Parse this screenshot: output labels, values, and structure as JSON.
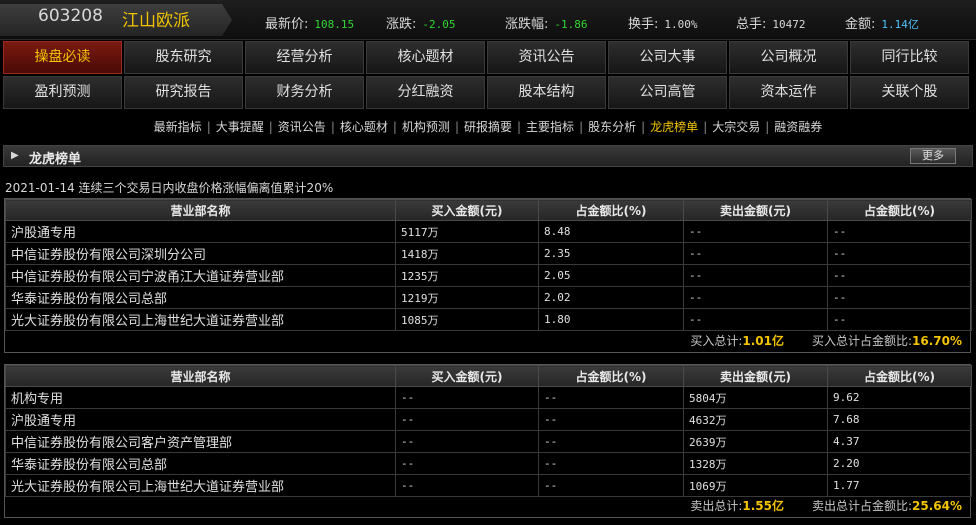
{
  "header": {
    "code": "603208",
    "name": "江山欧派",
    "quotes": [
      {
        "label": "最新价:",
        "value": "108.15",
        "color": "#33d633"
      },
      {
        "label": "涨跌:",
        "value": "-2.05",
        "color": "#33d633"
      },
      {
        "label": "涨跌幅:",
        "value": "-1.86",
        "color": "#33d633"
      },
      {
        "label": "换手:",
        "value": "1.00%",
        "color": "#d8d8d8"
      },
      {
        "label": "总手:",
        "value": "10472",
        "color": "#d8d8d8"
      },
      {
        "label": "金额:",
        "value": "1.14亿",
        "color": "#4fc3ff"
      }
    ]
  },
  "nav": {
    "row1": [
      "操盘必读",
      "股东研究",
      "经营分析",
      "核心题材",
      "资讯公告",
      "公司大事",
      "公司概况",
      "同行比较"
    ],
    "row2": [
      "盈利预测",
      "研究报告",
      "财务分析",
      "分红融资",
      "股本结构",
      "公司高管",
      "资本运作",
      "关联个股"
    ],
    "active": "操盘必读"
  },
  "subnav": {
    "items": [
      "最新指标",
      "大事提醒",
      "资讯公告",
      "核心题材",
      "机构预测",
      "研报摘要",
      "主要指标",
      "股东分析",
      "龙虎榜单",
      "大宗交易",
      "融资融券"
    ],
    "active": "龙虎榜单"
  },
  "section": {
    "title": "龙虎榜单",
    "more_label": "更多"
  },
  "caption": "2021-01-14 连续三个交易日内收盘价格涨幅偏离值累计20%",
  "buy_table": {
    "headers": [
      "营业部名称",
      "买入金额(元)",
      "占金额比(%)",
      "卖出金额(元)",
      "占金额比(%)"
    ],
    "rows": [
      [
        "沪股通专用",
        "5117万",
        "8.48",
        "--",
        "--"
      ],
      [
        "中信证券股份有限公司深圳分公司",
        "1418万",
        "2.35",
        "--",
        "--"
      ],
      [
        "中信证券股份有限公司宁波甬江大道证券营业部",
        "1235万",
        "2.05",
        "--",
        "--"
      ],
      [
        "华泰证券股份有限公司总部",
        "1219万",
        "2.02",
        "--",
        "--"
      ],
      [
        "光大证券股份有限公司上海世纪大道证券营业部",
        "1085万",
        "1.80",
        "--",
        "--"
      ]
    ],
    "summary": [
      {
        "label": "买入总计:",
        "value": "1.01亿"
      },
      {
        "label": "买入总计占金额比:",
        "value": "16.70%"
      }
    ]
  },
  "sell_table": {
    "headers": [
      "营业部名称",
      "买入金额(元)",
      "占金额比(%)",
      "卖出金额(元)",
      "占金额比(%)"
    ],
    "rows": [
      [
        "机构专用",
        "--",
        "--",
        "5804万",
        "9.62"
      ],
      [
        "沪股通专用",
        "--",
        "--",
        "4632万",
        "7.68"
      ],
      [
        "中信证券股份有限公司客户资产管理部",
        "--",
        "--",
        "2639万",
        "4.37"
      ],
      [
        "华泰证券股份有限公司总部",
        "--",
        "--",
        "1328万",
        "2.20"
      ],
      [
        "光大证券股份有限公司上海世纪大道证券营业部",
        "--",
        "--",
        "1069万",
        "1.77"
      ]
    ],
    "summary": [
      {
        "label": "卖出总计:",
        "value": "1.55亿"
      },
      {
        "label": "卖出总计占金额比:",
        "value": "25.64%"
      }
    ]
  }
}
